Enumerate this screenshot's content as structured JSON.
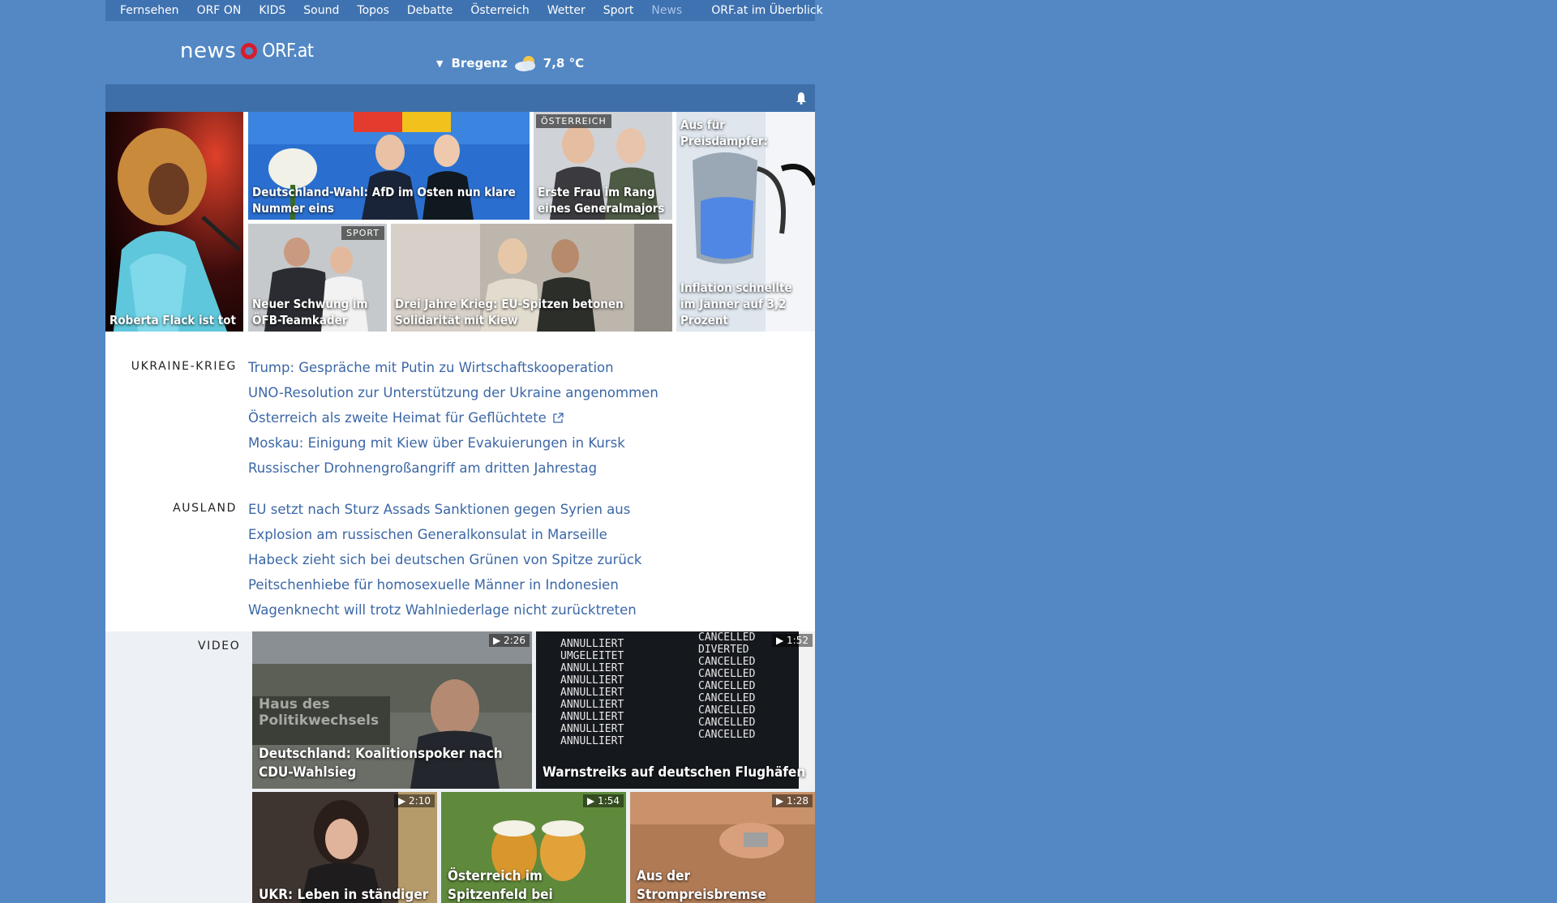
{
  "nav": {
    "items": [
      "Fernsehen",
      "ORF ON",
      "KIDS",
      "Sound",
      "Topos",
      "Debatte",
      "Österreich",
      "Wetter",
      "Sport",
      "News"
    ],
    "right": "ORF.at im Überblick"
  },
  "header": {
    "logo_news": "news",
    "logo_orf": "ORF.at",
    "weather_city": "Bregenz",
    "weather_temp": "7,8 °C"
  },
  "tiles": {
    "roberta": "Roberta Flack ist tot",
    "afd": "Deutschland-Wahl: AfD im Osten nun klare Nummer eins",
    "oesterreich_badge": "ÖSTERREICH",
    "general": "Erste Frau im Rang eines Generalmajors",
    "preis": "Aus für Preisdämpfer:",
    "inflation": "Inflation schnellte im Jänner auf 3,2 Prozent",
    "sport_badge": "SPORT",
    "oefb": "Neuer Schwung im ÖFB-Teamkader",
    "krieg": "Drei Jahre Krieg: EU-Spitzen betonen Solidarität mit Kiew"
  },
  "sections": {
    "ukraine": {
      "title": "UKRAINE-KRIEG",
      "links": [
        "Trump: Gespräche mit Putin zu Wirtschaftskooperation",
        "UNO-Resolution zur Unterstützung der Ukraine angenommen",
        "Österreich als zweite Heimat für Geflüchtete",
        "Moskau: Einigung mit Kiew über Evakuierungen in Kursk",
        "Russischer Drohnengroßangriff am dritten Jahrestag"
      ]
    },
    "ausland": {
      "title": "AUSLAND",
      "links": [
        "EU setzt nach Sturz Assads Sanktionen gegen Syrien aus",
        "Explosion am russischen Generalkonsulat in Marseille",
        "Habeck zieht sich bei deutschen Grünen von Spitze zurück",
        "Peitschenhiebe für homosexuelle Männer in Indonesien",
        "Wagenknecht will trotz Wahlniederlage nicht zurücktreten"
      ]
    }
  },
  "video": {
    "label": "VIDEO",
    "items": [
      {
        "title": "Deutschland: Koalitionspoker nach CDU-Wahlsieg",
        "duration": "▶ 2:26"
      },
      {
        "title": "Warnstreiks auf deutschen Flughäfen",
        "duration": "▶ 1:52"
      },
      {
        "title": "UKR: Leben in ständiger",
        "duration": "▶ 2:10"
      },
      {
        "title": "Österreich im Spitzenfeld bei",
        "duration": "▶ 1:54"
      },
      {
        "title": "Aus der Strompreisbremse",
        "duration": "▶ 1:28"
      }
    ],
    "board_left": [
      "ANNULLIERT",
      "UMGELEITET",
      "ANNULLIERT",
      "ANNULLIERT",
      "ANNULLIERT",
      "ANNULLIERT",
      "ANNULLIERT",
      "ANNULLIERT",
      "ANNULLIERT"
    ],
    "board_right": [
      "CANCELLED",
      "DIVERTED",
      "CANCELLED",
      "CANCELLED",
      "CANCELLED",
      "CANCELLED",
      "CANCELLED",
      "CANCELLED",
      "CANCELLED"
    ],
    "sign_text": "Haus des Politikwechsels"
  },
  "colors": {
    "background": "#5388c4",
    "nav": "#3f72b0",
    "link": "#3b67a6",
    "logo_red": "#d71d2d"
  }
}
